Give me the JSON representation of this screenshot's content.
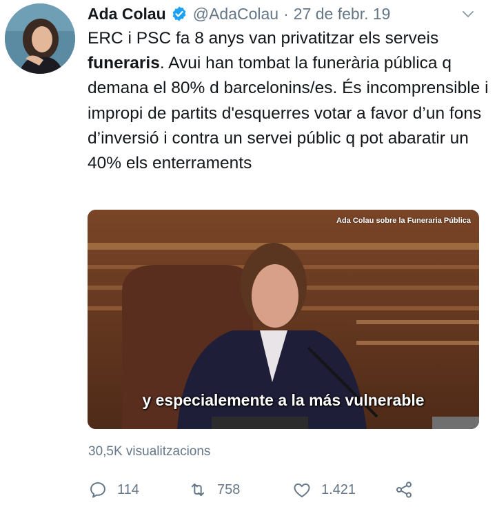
{
  "tweet": {
    "author_name": "Ada Colau",
    "handle": "@AdaColau",
    "separator": "·",
    "date": "27 de febr. 19",
    "text_before_bold": "ERC i PSC fa 8 anys van privatitzar els serveis ",
    "text_bold": "funeraris",
    "text_after_bold": ". Avui han tombat la funerària pública q demana el 80% d barcelonins/es. És incomprensible i impropi de partits d'esquerres votar a favor d’un fons d’inversió i contra un servei públic q pot abaratir un 40% els enterraments",
    "views": "30,5K visualitzacions"
  },
  "video": {
    "watermark": "Ada Colau sobre la Funeraria Pública",
    "subtitle": "y especialemente a la más vulnerable"
  },
  "actions": {
    "replies": "114",
    "retweets": "758",
    "likes": "1.421"
  },
  "icons": {
    "verified": "verified-badge-icon",
    "caret": "chevron-down-icon",
    "reply": "reply-icon",
    "retweet": "retweet-icon",
    "like": "heart-icon",
    "share": "share-icon"
  },
  "colors": {
    "text": "#14171a",
    "muted": "#657786",
    "verified": "#1da1f2"
  }
}
